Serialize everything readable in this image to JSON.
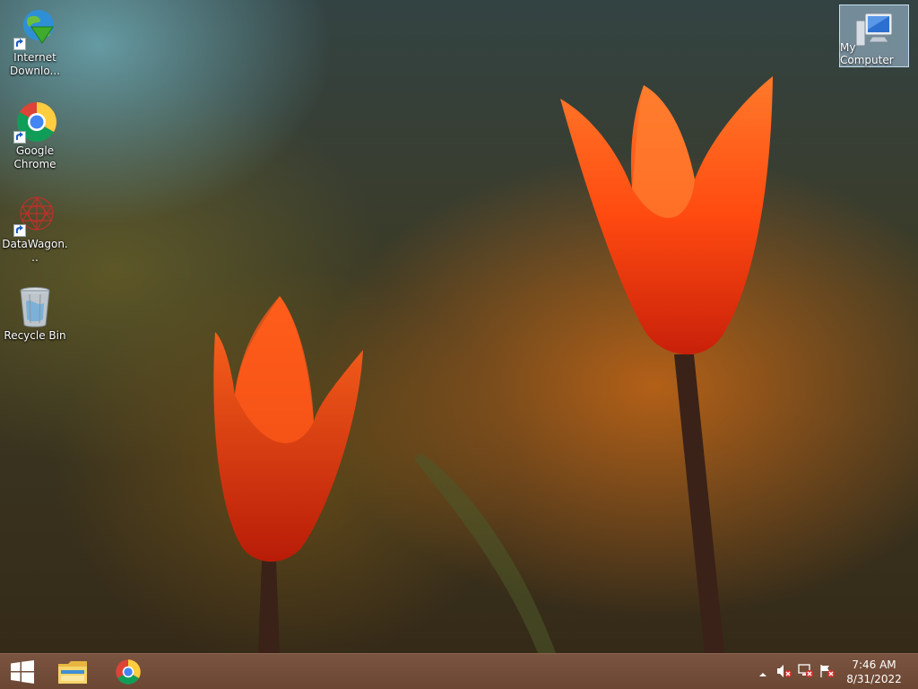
{
  "desktop": {
    "icons": [
      {
        "label": "Internet\nDownlo...",
        "icon": "idm-globe-icon"
      },
      {
        "label": "Google\nChrome",
        "icon": "chrome-icon"
      },
      {
        "label": "DataWagon...",
        "icon": "datawagon-icon"
      },
      {
        "label": "Recycle Bin",
        "icon": "recycle-bin-icon"
      },
      {
        "label": "My Computer",
        "icon": "computer-icon"
      }
    ]
  },
  "taskbar": {
    "start_icon": "windows-logo-icon",
    "pinned": [
      {
        "name": "File Explorer",
        "icon": "folder-icon"
      },
      {
        "name": "Google Chrome",
        "icon": "chrome-icon"
      }
    ],
    "tray": {
      "icons": [
        "chevron-up-icon",
        "speaker-muted-icon",
        "network-icon",
        "action-center-flag-icon"
      ],
      "time": "7:46 AM",
      "date": "8/31/2022"
    }
  },
  "colors": {
    "taskbar": "#6e4a36",
    "selection": "#aac8e1",
    "tulip": "#ff4a10"
  }
}
